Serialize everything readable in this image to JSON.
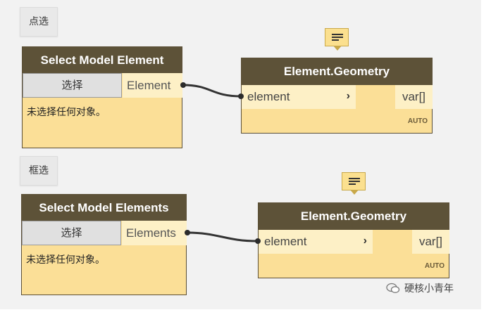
{
  "groups": {
    "point_select": "点选",
    "box_select": "框选"
  },
  "select_node_1": {
    "title": "Select Model Element",
    "button": "选择",
    "output": "Element",
    "status": "未选择任何对象。"
  },
  "geometry_node_1": {
    "title": "Element.Geometry",
    "input": "element",
    "output": "var[]",
    "lacing": "AUTO"
  },
  "select_node_2": {
    "title": "Select Model Elements",
    "button": "选择",
    "output": "Elements",
    "status": "未选择任何对象。"
  },
  "geometry_node_2": {
    "title": "Element.Geometry",
    "input": "element",
    "output": "var[]",
    "lacing": "AUTO"
  },
  "watermark": "硬核小青年",
  "icons": {
    "port_arrow": "chevron-right-icon",
    "note": "note-icon",
    "watermark": "wechat-icon"
  },
  "colors": {
    "header": "#5d5238",
    "node_body": "#fbdf97",
    "port": "#fdf0c6",
    "wire": "#333333"
  }
}
